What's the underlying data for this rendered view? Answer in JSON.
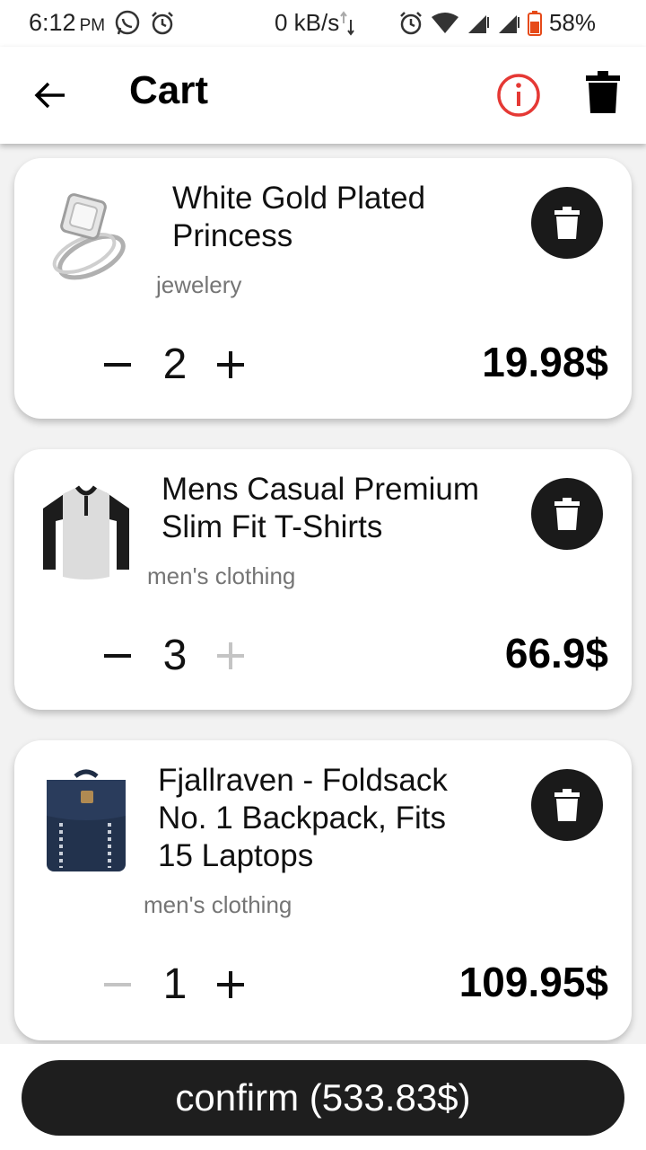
{
  "status_bar": {
    "time": "6:12",
    "meridiem": "PM",
    "network_speed": "0 kB/s",
    "battery": "58%"
  },
  "app_bar": {
    "title": "Cart"
  },
  "cart": {
    "items": [
      {
        "title_line1": "White Gold Plated",
        "title_line2": "Princess",
        "title_line3": "",
        "category": "jewelery",
        "quantity": "2",
        "price": "19.98$",
        "image_icon": "ring-image"
      },
      {
        "title_line1": "Mens Casual Premium",
        "title_line2": "Slim Fit T-Shirts",
        "title_line3": "",
        "category": "men's clothing",
        "quantity": "3",
        "price": "66.9$",
        "image_icon": "tshirt-image"
      },
      {
        "title_line1": "Fjallraven - Foldsack",
        "title_line2": "No. 1 Backpack, Fits",
        "title_line3": "15 Laptops",
        "category": "men's clothing",
        "quantity": "1",
        "price": "109.95$",
        "image_icon": "backpack-image"
      }
    ]
  },
  "confirm": {
    "label": "confirm (533.83$)"
  },
  "colors": {
    "info_accent": "#e53935",
    "button_dark": "#1e1e1e",
    "category_gray": "#757575",
    "disabled_gray": "#c4c4c4"
  }
}
